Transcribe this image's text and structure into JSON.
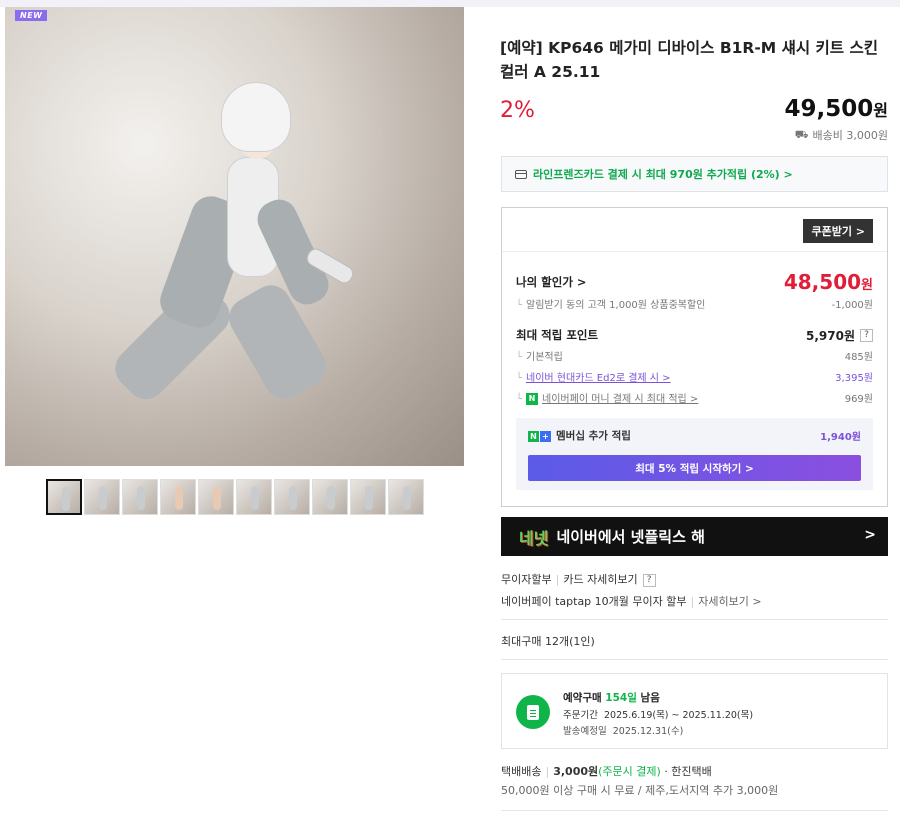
{
  "gallery": {
    "badge": "NEW",
    "thumbnail_count": 10
  },
  "product": {
    "title": "[예약] KP646 메가미 디바이스 B1R-M 섀시 키트 스킨 컬러 A 25.11",
    "discount_rate": "2%",
    "price": "49,500",
    "price_unit": "원",
    "shipping": "배송비 3,000원"
  },
  "card_promo": {
    "text": "라인프렌즈카드 결제 시 최대 970원 추가적립 (2%) >"
  },
  "benefits": {
    "coupon_button": "쿠폰받기 >",
    "my_price_label": "나의 할인가 >",
    "my_price": "48,500",
    "my_price_unit": "원",
    "discount_note": "알림받기 동의 고객 1,000원 상품중복할인",
    "discount_value": "-1,000원",
    "max_points_label": "최대 적립 포인트",
    "max_points": "5,970원",
    "help_mark": "?",
    "basic_label": "기본적립",
    "basic_value": "485원",
    "card_label": "네이버 현대카드 Ed2로 결제 시 >",
    "card_value": "3,395원",
    "npay_label": "네이버페이 머니 결제 시 최대 적립 >",
    "npay_value": "969원",
    "npay_icon": "N",
    "membership_label": "멤버십 추가 적립",
    "membership_value": "1,940원",
    "membership_button": "최대 5% 적립 시작하기 >"
  },
  "banner": {
    "logo": "네넷",
    "text": "네이버에서 넷플릭스 해",
    "arrow": ">"
  },
  "installment": {
    "label": "무이자할부",
    "detail_link": "카드 자세히보기",
    "help_mark": "?",
    "taptap": "네이버페이 taptap 10개월 무이자 할부",
    "taptap_link": "자세히보기 >"
  },
  "max_purchase": "최대구매 12개(1인)",
  "preorder": {
    "title_prefix": "예약구매",
    "days": "154일",
    "title_suffix": "남음",
    "order_period_label": "주문기간",
    "order_period": "2025.6.19(목) ~ 2025.11.20(목)",
    "ship_label": "발송예정일",
    "ship_date": "2025.12.31(수)"
  },
  "delivery": {
    "type": "택배배송",
    "fee": "3,000원",
    "fee_note": "(주문시 결제)",
    "courier": "· 한진택배",
    "condition": "50,000원 이상 구매 시 무료 / 제주,도서지역 추가 3,000원"
  }
}
